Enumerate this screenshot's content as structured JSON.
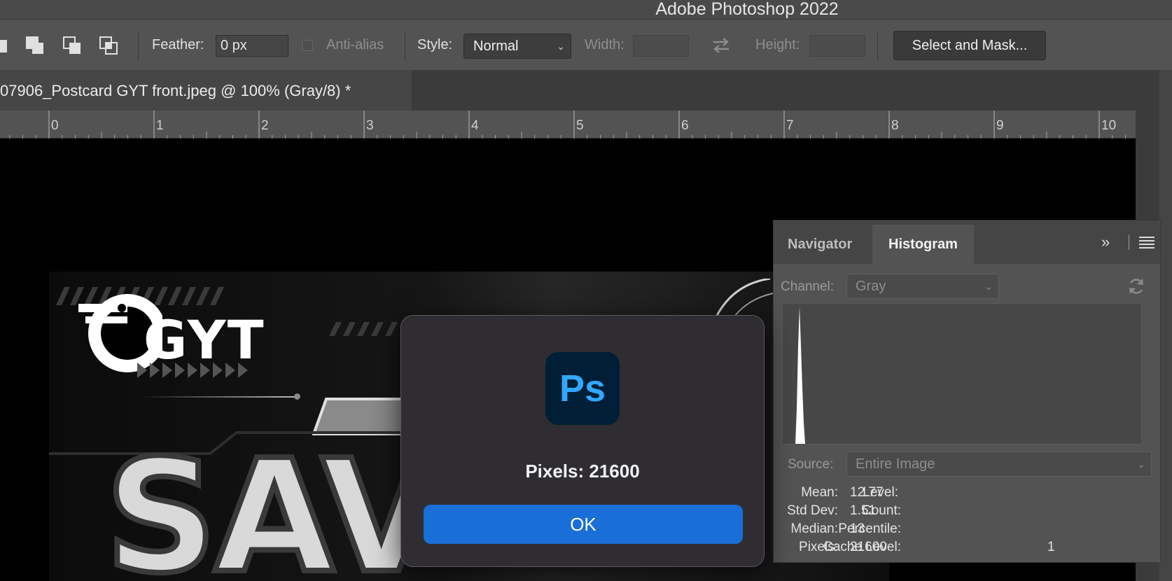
{
  "app": {
    "window_title": "Adobe Photoshop 2022"
  },
  "options_bar": {
    "feather_label": "Feather:",
    "feather_value": "0 px",
    "anti_alias_label": "Anti-alias",
    "style_label": "Style:",
    "style_value": "Normal",
    "width_label": "Width:",
    "width_value": "",
    "swap_icon": "swap-arrows-icon",
    "height_label": "Height:",
    "height_value": "",
    "select_mask_label": "Select and Mask..."
  },
  "document": {
    "tab_title": "07906_Postcard GYT front.jpeg @ 100% (Gray/8) *"
  },
  "ruler": {
    "numbers": [
      "0",
      "1",
      "2",
      "3",
      "4",
      "5",
      "6",
      "7",
      "8",
      "9",
      "10"
    ]
  },
  "canvas_image": {
    "logo_text": "GYT",
    "headline_text": "SAV"
  },
  "histogram_panel": {
    "tabs": [
      "Navigator",
      "Histogram"
    ],
    "active_tab": "Histogram",
    "channel_label": "Channel:",
    "channel_value": "Gray",
    "source_label": "Source:",
    "source_value": "Entire Image",
    "stats": {
      "mean_label": "Mean:",
      "mean": "12.77",
      "std_label": "Std Dev:",
      "std": "1.51",
      "median_label": "Median:",
      "median": "13",
      "pixels_label": "Pixels:",
      "pixels": "21600",
      "level_label": "Level:",
      "level": "",
      "count_label": "Count:",
      "count": "",
      "percentile_label": "Percentile:",
      "percentile": "",
      "cache_label": "Cache Level:",
      "cache": "1"
    }
  },
  "dialog": {
    "app_icon_text": "Ps",
    "message": "Pixels: 21600",
    "ok_label": "OK"
  },
  "colors": {
    "accent_button": "#1a6ed8",
    "ps_icon_bg": "#001e36",
    "ps_icon_fg": "#31a8ff"
  }
}
